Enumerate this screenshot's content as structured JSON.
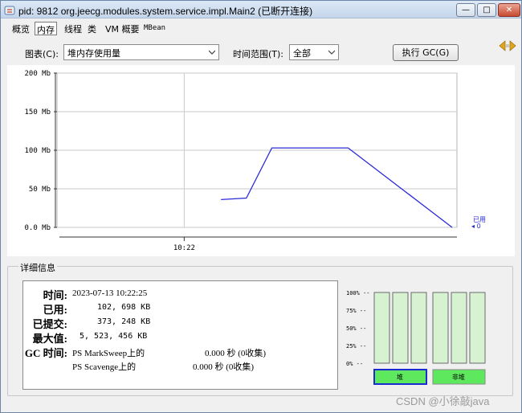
{
  "window": {
    "title": "pid: 9812 org.jeecg.modules.system.service.impl.Main2 (已断开连接)",
    "minimize_symbol": "—",
    "maximize_symbol": "□",
    "close_symbol": "✕"
  },
  "tabs": [
    {
      "label": "概览"
    },
    {
      "label": "内存",
      "active": true
    },
    {
      "label": "线程"
    },
    {
      "label": "类"
    },
    {
      "label": "VM 概要"
    },
    {
      "label": "MBean"
    }
  ],
  "toolbar": {
    "chart_label": "图表(C):",
    "chart_value": "堆内存使用量",
    "range_label": "时间范围(T):",
    "range_value": "全部",
    "gc_button": "执行 GC(G)"
  },
  "chart_data": {
    "type": "line",
    "y_unit": "Mb",
    "ylim": [
      0,
      200
    ],
    "y_ticks": [
      "0.0 Mb",
      "50 Mb",
      "100 Mb",
      "150 Mb",
      "200 Mb"
    ],
    "y_tick_values": [
      0,
      50,
      100,
      150,
      200
    ],
    "x_tick_labels": [
      "10:22"
    ],
    "grid": true,
    "series": [
      {
        "name": "已用",
        "color": "#2b2bd8",
        "points": [
          {
            "t": 0.0,
            "y": 36
          },
          {
            "t": 0.11,
            "y": 38
          },
          {
            "t": 0.22,
            "y": 103
          },
          {
            "t": 0.55,
            "y": 103
          },
          {
            "t": 1.0,
            "y": 0
          }
        ]
      }
    ],
    "legend": {
      "label": "已用",
      "value": "0",
      "placement": "right"
    }
  },
  "details": {
    "section_title": "详细信息",
    "time_label": "时间:",
    "time_value": "2023-07-13 10:22:25",
    "used_label": "已用:",
    "used_value": "102, 698 KB",
    "committed_label": "已提交:",
    "committed_value": "373, 248 KB",
    "max_label": "最大值:",
    "max_value": "5, 523, 456 KB",
    "gc_label": "GC 时间:",
    "gc_rows": [
      {
        "name": "PS MarkSweep上的",
        "value": "0.000 秒 (0收集)"
      },
      {
        "name": "PS Scavenge上的",
        "value": "0.000 秒 (0收集)"
      }
    ]
  },
  "pool_bars": {
    "y_ticks": [
      "100% --",
      "75% --",
      "50% --",
      "25% --",
      "0% --"
    ],
    "heap_label": "堆",
    "nonheap_label": "非堆",
    "bar_fill_color": "#d6f2d0",
    "selected_color": "#5ee85e",
    "levels": [
      0,
      0,
      0,
      0,
      0,
      0
    ]
  },
  "watermark": "CSDN @小徐敲java"
}
